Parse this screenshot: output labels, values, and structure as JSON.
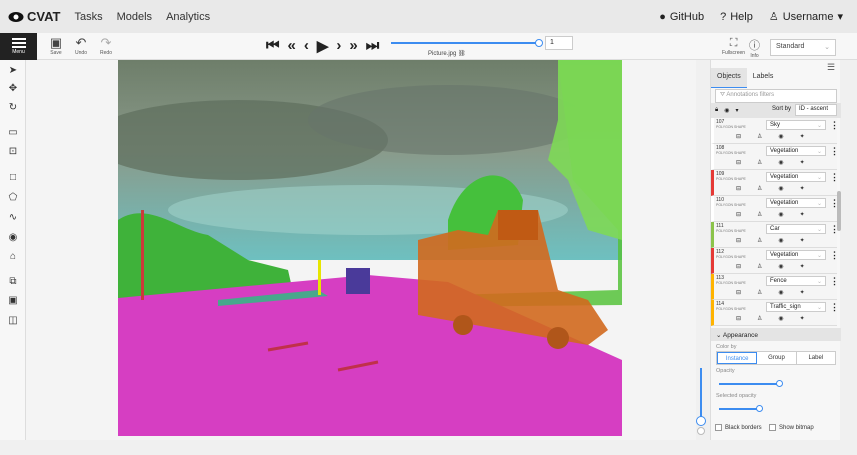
{
  "app": {
    "logo": "CVAT"
  },
  "nav": {
    "tasks": "Tasks",
    "models": "Models",
    "analytics": "Analytics"
  },
  "top_right": {
    "github": "GitHub",
    "help": "Help",
    "user": "Username"
  },
  "toolbar": {
    "menu": "Menu",
    "save": "Save",
    "undo": "Undo",
    "redo": "Redo",
    "frame_value": "1",
    "filename": "Picture.jpg",
    "fullscreen": "Fullscreen",
    "info": "Info",
    "workspace": "Standard"
  },
  "sidebar": {
    "tab_objects": "Objects",
    "tab_labels": "Labels",
    "filter_placeholder": "Annotations filters",
    "sort_label": "Sort by",
    "sort_value": "ID - ascent",
    "objects": [
      {
        "id": "107",
        "type": "POLYGON SHAPE",
        "label": "Sky",
        "color": "#ffffff"
      },
      {
        "id": "108",
        "type": "POLYGON SHAPE",
        "label": "Vegetation",
        "color": "#ffffff"
      },
      {
        "id": "109",
        "type": "POLYGON SHAPE",
        "label": "Vegetation",
        "color": "#e53935"
      },
      {
        "id": "110",
        "type": "POLYGON SHAPE",
        "label": "Vegetation",
        "color": "#ffffff"
      },
      {
        "id": "111",
        "type": "POLYGON SHAPE",
        "label": "Car",
        "color": "#8bc34a"
      },
      {
        "id": "112",
        "type": "POLYGON SHAPE",
        "label": "Vegetation",
        "color": "#e53935"
      },
      {
        "id": "113",
        "type": "POLYGON SHAPE",
        "label": "Fence",
        "color": "#ffb300"
      },
      {
        "id": "114",
        "type": "POLYGON SHAPE",
        "label": "Traffic_sign",
        "color": "#ffb300"
      }
    ],
    "appearance": {
      "title": "Appearance",
      "color_by": "Color by",
      "instance": "Instance",
      "group": "Group",
      "label": "Label",
      "opacity": "Opacity",
      "opacity_value": 0.6,
      "selected_opacity": "Selected opacity",
      "selected_opacity_value": 0.4,
      "black_borders": "Black borders",
      "show_bitmap": "Show bitmap"
    }
  },
  "colors": {
    "accent": "#3c8cf0",
    "road": "#d63ec2",
    "vegetation": "#55c23a",
    "truck": "#d2691e",
    "sky": "#5a8a8a"
  }
}
